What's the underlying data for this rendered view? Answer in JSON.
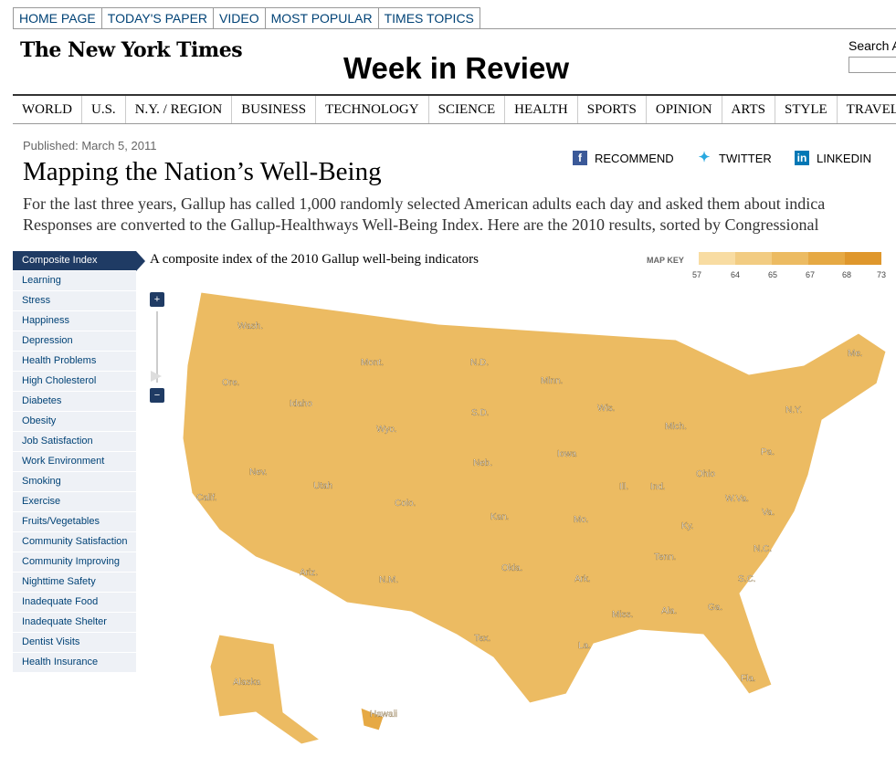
{
  "top_nav": [
    "HOME PAGE",
    "TODAY'S PAPER",
    "VIDEO",
    "MOST POPULAR",
    "TIMES TOPICS"
  ],
  "masthead": {
    "logo": "The New York Times",
    "section": "Week in Review",
    "search_label": "Search All"
  },
  "section_nav": [
    "WORLD",
    "U.S.",
    "N.Y. / REGION",
    "BUSINESS",
    "TECHNOLOGY",
    "SCIENCE",
    "HEALTH",
    "SPORTS",
    "OPINION",
    "ARTS",
    "STYLE",
    "TRAVEL"
  ],
  "article": {
    "published": "Published: March 5, 2011",
    "headline": "Mapping the Nation’s Well-Being",
    "deck_line1": "For the last three years, Gallup has called 1,000 randomly selected American adults each day and asked them about indica",
    "deck_line2": "Responses are converted to the Gallup-Healthways Well-Being Index. Here are the 2010 results, sorted by Congressional"
  },
  "share": {
    "recommend": "RECOMMEND",
    "twitter": "TWITTER",
    "linkedin": "LINKEDIN"
  },
  "sidebar": [
    "Composite Index",
    "Learning",
    "Stress",
    "Happiness",
    "Depression",
    "Health Problems",
    "High Cholesterol",
    "Diabetes",
    "Obesity",
    "Job Satisfaction",
    "Work Environment",
    "Smoking",
    "Exercise",
    "Fruits/Vegetables",
    "Community Satisfaction",
    "Community Improving",
    "Nighttime Safety",
    "Inadequate Food",
    "Inadequate Shelter",
    "Dentist Visits",
    "Health Insurance"
  ],
  "map": {
    "caption": "A composite index of the 2010 Gallup well-being indicators",
    "legend_label": "MAP KEY",
    "legend_ticks": [
      "57",
      "64",
      "65",
      "67",
      "68",
      "73"
    ],
    "legend_colors": [
      "#f8dca2",
      "#f2cc82",
      "#ecbb62",
      "#e6a944",
      "#df972c"
    ],
    "states": [
      "Wash.",
      "Ore.",
      "Idaho",
      "Mont.",
      "N.D.",
      "Minn.",
      "Wis.",
      "Mich.",
      "Me.",
      "Calif.",
      "Nev.",
      "Utah",
      "Wyo.",
      "S.D.",
      "Neb.",
      "Iowa",
      "Ill.",
      "Ind.",
      "Ohio",
      "Pa.",
      "N.Y.",
      "Colo.",
      "Kan.",
      "Mo.",
      "Ky.",
      "W.Va.",
      "Va.",
      "Ariz.",
      "N.M.",
      "Okla.",
      "Ark.",
      "Tenn.",
      "N.C.",
      "S.C.",
      "Tex.",
      "La.",
      "Miss.",
      "Ala.",
      "Ga.",
      "Fla.",
      "Alaska",
      "Hawaii"
    ]
  }
}
